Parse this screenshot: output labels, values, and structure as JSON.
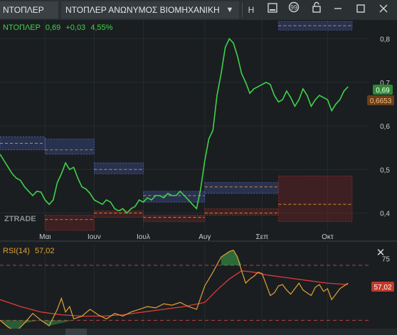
{
  "toolbar": {
    "symbol": "ΝΤΟΠΛΕΡ",
    "name": "ΝΤΟΠΛΕΡ ΑΝΩΝΥΜΟΣ ΒΙΟΜΗΧΑΝΙΚΗ",
    "dropdown_icon": "chevron-down-icon",
    "interval": "H",
    "icons": [
      "save-icon",
      "comment-icon",
      "lock-icon",
      "maximize-icon",
      "close-icon"
    ]
  },
  "price_panel": {
    "legend_symbol": "ΝΤΟΠΛΕΡ",
    "legend_last": "0,69",
    "legend_change": "+0,03",
    "legend_pct": "4,55%",
    "price_tag": "0,69",
    "avg_tag": "0,6653",
    "watermark": "ZTRADE",
    "x_ticks": [
      "Μαι",
      "Ιουν",
      "Ιουλ",
      "Αυγ",
      "Σεπ",
      "Οκτ"
    ],
    "y_ticks": [
      "0,8",
      "0,7",
      "0,6",
      "0,5",
      "0,4"
    ]
  },
  "rsi_panel": {
    "label": "RSI(14)",
    "value": "57,02",
    "value_tag": "57,02",
    "y_ticks": [
      "75"
    ],
    "close_icon": "close-icon"
  },
  "colors": {
    "price_line": "#3fd24a",
    "rsi_line": "#e2a236",
    "rsi_ma": "#e03a3a",
    "price_tag_bg": "#2f8a35",
    "avg_tag_bg": "#6b3e1a",
    "value_tag_bg": "#c0392b"
  },
  "chart_data": [
    {
      "type": "line",
      "series": [
        {
          "name": "ΝΤΟΠΛΕΡ",
          "points": [
            [
              0,
              0.535
            ],
            [
              2,
              0.52
            ],
            [
              4,
              0.505
            ],
            [
              6,
              0.49
            ],
            [
              8,
              0.48
            ],
            [
              10,
              0.475
            ],
            [
              12,
              0.46
            ],
            [
              14,
              0.45
            ],
            [
              16,
              0.44
            ],
            [
              18,
              0.45
            ],
            [
              20,
              0.448
            ],
            [
              22,
              0.43
            ],
            [
              24,
              0.42
            ],
            [
              26,
              0.43
            ],
            [
              28,
              0.47
            ],
            [
              30,
              0.49
            ],
            [
              32,
              0.515
            ],
            [
              34,
              0.5
            ],
            [
              36,
              0.505
            ],
            [
              38,
              0.48
            ],
            [
              40,
              0.46
            ],
            [
              42,
              0.455
            ],
            [
              44,
              0.445
            ],
            [
              46,
              0.43
            ],
            [
              48,
              0.425
            ],
            [
              50,
              0.42
            ],
            [
              52,
              0.43
            ],
            [
              54,
              0.425
            ],
            [
              56,
              0.41
            ],
            [
              58,
              0.405
            ],
            [
              60,
              0.41
            ],
            [
              62,
              0.4
            ],
            [
              64,
              0.41
            ],
            [
              66,
              0.415
            ],
            [
              68,
              0.43
            ],
            [
              70,
              0.425
            ],
            [
              72,
              0.435
            ],
            [
              74,
              0.43
            ],
            [
              76,
              0.44
            ],
            [
              78,
              0.44
            ],
            [
              80,
              0.435
            ],
            [
              82,
              0.445
            ],
            [
              84,
              0.44
            ],
            [
              86,
              0.44
            ],
            [
              88,
              0.45
            ],
            [
              90,
              0.44
            ],
            [
              92,
              0.43
            ],
            [
              94,
              0.42
            ],
            [
              96,
              0.41
            ],
            [
              98,
              0.455
            ],
            [
              100,
              0.52
            ],
            [
              102,
              0.57
            ],
            [
              104,
              0.59
            ],
            [
              106,
              0.67
            ],
            [
              108,
              0.72
            ],
            [
              110,
              0.78
            ],
            [
              112,
              0.8
            ],
            [
              114,
              0.79
            ],
            [
              116,
              0.76
            ],
            [
              118,
              0.72
            ],
            [
              120,
              0.7
            ],
            [
              122,
              0.675
            ],
            [
              124,
              0.685
            ],
            [
              126,
              0.69
            ],
            [
              128,
              0.695
            ],
            [
              130,
              0.7
            ],
            [
              132,
              0.695
            ],
            [
              134,
              0.67
            ],
            [
              136,
              0.655
            ],
            [
              138,
              0.66
            ],
            [
              140,
              0.68
            ],
            [
              142,
              0.665
            ],
            [
              144,
              0.645
            ],
            [
              146,
              0.66
            ],
            [
              148,
              0.685
            ],
            [
              150,
              0.67
            ],
            [
              152,
              0.645
            ],
            [
              154,
              0.66
            ],
            [
              156,
              0.67
            ],
            [
              158,
              0.665
            ],
            [
              160,
              0.66
            ],
            [
              162,
              0.635
            ],
            [
              164,
              0.65
            ],
            [
              166,
              0.66
            ],
            [
              168,
              0.68
            ],
            [
              170,
              0.69
            ]
          ]
        }
      ],
      "x_labels": [
        "Μαι",
        "Ιουν",
        "Ιουλ",
        "Αυγ",
        "Σεπ",
        "Οκτ"
      ],
      "ylim": [
        0.36,
        0.84
      ],
      "right_axis": true,
      "grid": true,
      "value_boxes": [
        {
          "start": 0,
          "end": 22,
          "high": 0.575,
          "low": 0.545,
          "mid": 0.56,
          "color": "blue"
        },
        {
          "start": 22,
          "end": 46,
          "high": 0.57,
          "low": 0.535,
          "mid": 0.545,
          "color": "blue"
        },
        {
          "start": 46,
          "end": 70,
          "high": 0.515,
          "low": 0.49,
          "mid": 0.5,
          "color": "blue"
        },
        {
          "start": 70,
          "end": 100,
          "high": 0.45,
          "low": 0.425,
          "mid": 0.44,
          "color": "blue"
        },
        {
          "start": 100,
          "end": 136,
          "high": 0.47,
          "low": 0.445,
          "mid": 0.46,
          "color": "blue"
        },
        {
          "start": 136,
          "end": 172,
          "high": 0.84,
          "low": 0.82,
          "mid": 0.83,
          "color": "blue"
        },
        {
          "start": 22,
          "end": 46,
          "high": 0.395,
          "low": 0.36,
          "mid": 0.385,
          "color": "red"
        },
        {
          "start": 46,
          "end": 70,
          "high": 0.405,
          "low": 0.39,
          "mid": 0.4,
          "color": "red"
        },
        {
          "start": 70,
          "end": 100,
          "high": 0.395,
          "low": 0.38,
          "mid": 0.39,
          "color": "red"
        },
        {
          "start": 100,
          "end": 136,
          "high": 0.41,
          "low": 0.395,
          "mid": 0.4,
          "color": "red"
        },
        {
          "start": 136,
          "end": 172,
          "high": 0.485,
          "low": 0.38,
          "mid": 0.42,
          "color": "red"
        }
      ]
    },
    {
      "type": "line",
      "series": [
        {
          "name": "RSI(14)",
          "points": [
            [
              0,
              30
            ],
            [
              4,
              25
            ],
            [
              8,
              22
            ],
            [
              12,
              28
            ],
            [
              16,
              35
            ],
            [
              20,
              30
            ],
            [
              24,
              26
            ],
            [
              28,
              38
            ],
            [
              30,
              46
            ],
            [
              32,
              36
            ],
            [
              34,
              40
            ],
            [
              36,
              31
            ],
            [
              40,
              33
            ],
            [
              44,
              38
            ],
            [
              48,
              34
            ],
            [
              52,
              31
            ],
            [
              56,
              35
            ],
            [
              60,
              33
            ],
            [
              64,
              36
            ],
            [
              68,
              38
            ],
            [
              72,
              40
            ],
            [
              76,
              39
            ],
            [
              80,
              42
            ],
            [
              84,
              41
            ],
            [
              88,
              43
            ],
            [
              92,
              40
            ],
            [
              96,
              38
            ],
            [
              100,
              55
            ],
            [
              104,
              65
            ],
            [
              108,
              76
            ],
            [
              112,
              80
            ],
            [
              114,
              81
            ],
            [
              116,
              76
            ],
            [
              118,
              66
            ],
            [
              120,
              57
            ],
            [
              122,
              60
            ],
            [
              124,
              62
            ],
            [
              126,
              65
            ],
            [
              128,
              64
            ],
            [
              130,
              56
            ],
            [
              132,
              48
            ],
            [
              134,
              50
            ],
            [
              136,
              55
            ],
            [
              138,
              56
            ],
            [
              140,
              52
            ],
            [
              142,
              49
            ],
            [
              144,
              53
            ],
            [
              146,
              57
            ],
            [
              148,
              52
            ],
            [
              150,
              50
            ],
            [
              152,
              48
            ],
            [
              154,
              54
            ],
            [
              156,
              56
            ],
            [
              158,
              51
            ],
            [
              160,
              53
            ],
            [
              162,
              45
            ],
            [
              164,
              49
            ],
            [
              166,
              53
            ],
            [
              168,
              55
            ],
            [
              170,
              57
            ]
          ]
        },
        {
          "name": "RSI MA",
          "points": [
            [
              0,
              45
            ],
            [
              10,
              40
            ],
            [
              20,
              36
            ],
            [
              30,
              34
            ],
            [
              40,
              33
            ],
            [
              50,
              33
            ],
            [
              60,
              34
            ],
            [
              70,
              36
            ],
            [
              80,
              38
            ],
            [
              90,
              40
            ],
            [
              100,
              43
            ],
            [
              106,
              52
            ],
            [
              112,
              60
            ],
            [
              118,
              66
            ],
            [
              124,
              65
            ],
            [
              130,
              63
            ],
            [
              140,
              61
            ],
            [
              150,
              59
            ],
            [
              160,
              57
            ],
            [
              170,
              56
            ]
          ]
        }
      ],
      "ylim": [
        25,
        85
      ],
      "levels": [
        70,
        30
      ]
    }
  ]
}
